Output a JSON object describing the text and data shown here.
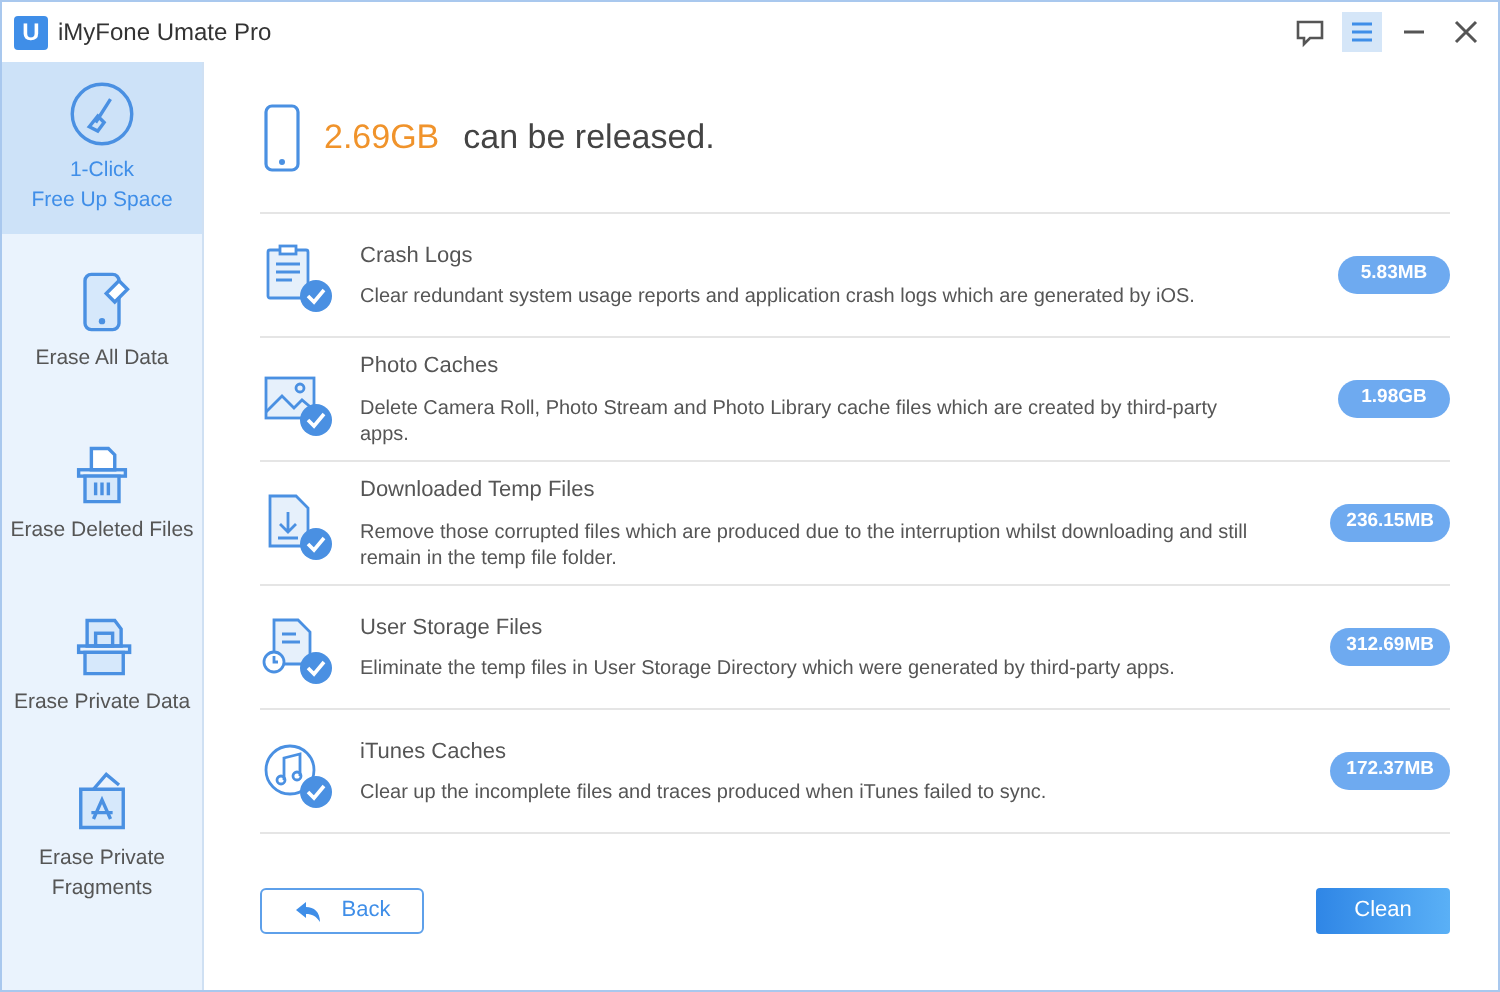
{
  "window": {
    "title": "iMyFone Umate Pro",
    "logo": "U"
  },
  "sidebar": {
    "items": [
      {
        "label": "1-Click\nFree Up Space",
        "selected": true
      },
      {
        "label": "Erase All Data",
        "selected": false
      },
      {
        "label": "Erase Deleted Files",
        "selected": false
      },
      {
        "label": "Erase Private Data",
        "selected": false
      },
      {
        "label": "Erase Private Fragments",
        "selected": false
      }
    ]
  },
  "summary": {
    "size": "2.69GB",
    "text": "can be released."
  },
  "items": [
    {
      "title": "Crash Logs",
      "description": "Clear redundant system usage reports and application crash logs which are generated by iOS.",
      "size": "5.83MB",
      "checked": true
    },
    {
      "title": "Photo Caches",
      "description": "Delete Camera Roll, Photo Stream and Photo Library cache files which are created by third-party apps.",
      "size": "1.98GB",
      "checked": true
    },
    {
      "title": "Downloaded Temp Files",
      "description": "Remove those corrupted files which are produced due to the interruption whilst downloading and still remain in the temp file folder.",
      "size": "236.15MB",
      "checked": true
    },
    {
      "title": "User Storage Files",
      "description": "Eliminate the temp files in User Storage Directory which were generated by third-party apps.",
      "size": "312.69MB",
      "checked": true
    },
    {
      "title": "iTunes Caches",
      "description": "Clear up the incomplete files and traces produced when iTunes failed to sync.",
      "size": "172.37MB",
      "checked": true
    }
  ],
  "buttons": {
    "back": "Back",
    "clean": "Clean"
  }
}
